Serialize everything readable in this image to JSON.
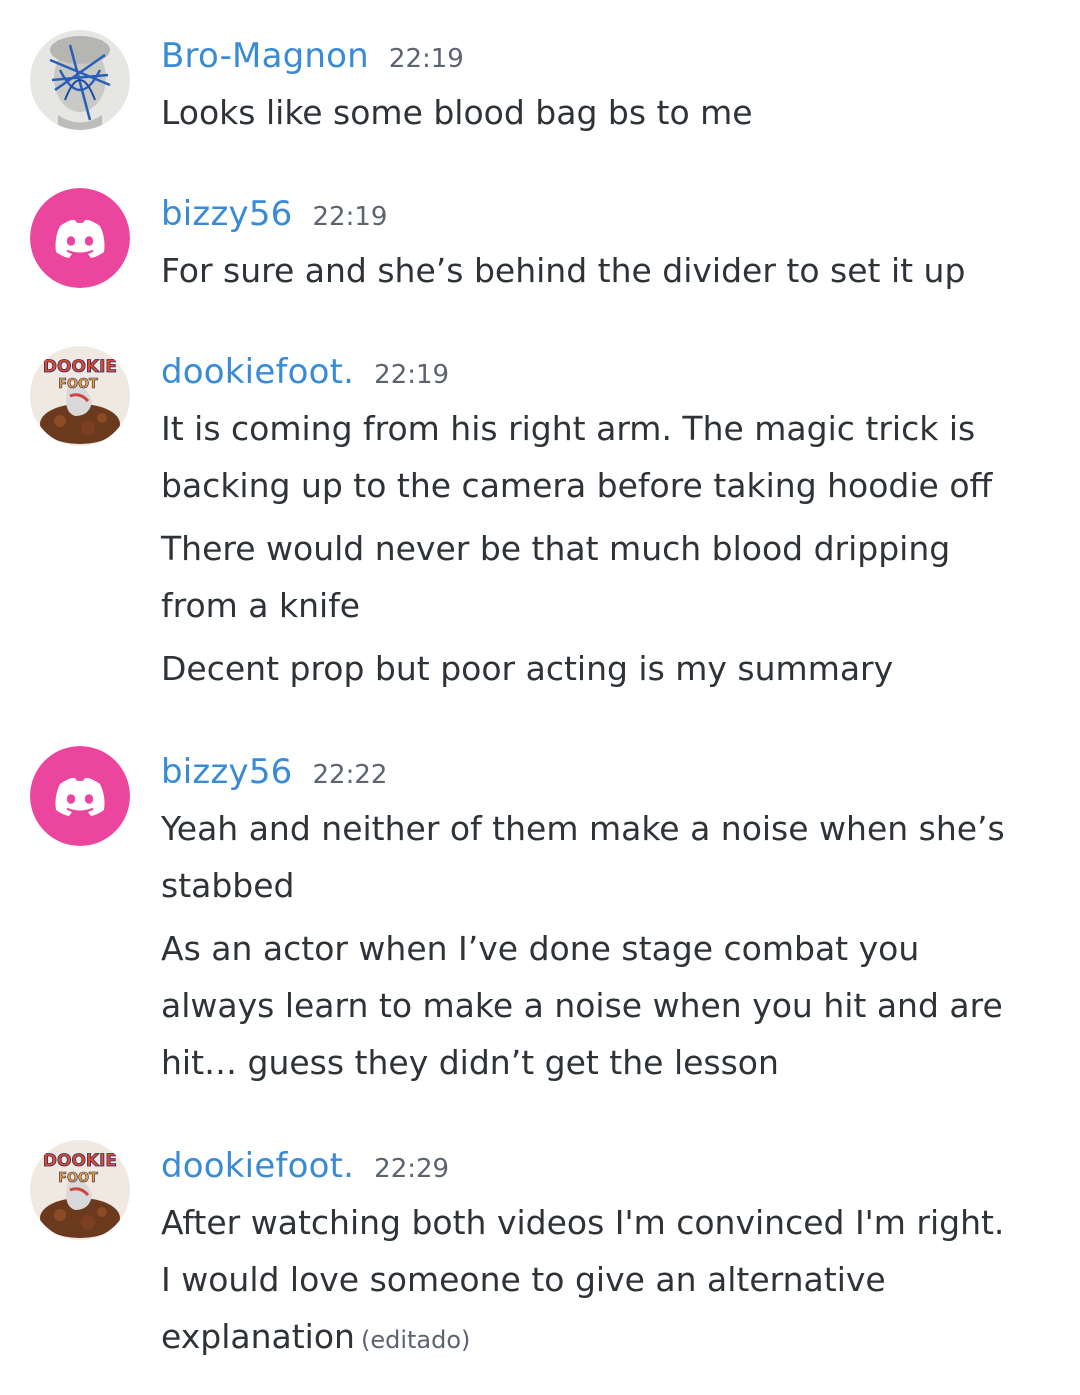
{
  "messages": [
    {
      "username": "Bro-Magnon",
      "time": "22:19",
      "avatar": "statue-avatar",
      "lines": [
        "Looks like some blood bag bs to me"
      ]
    },
    {
      "username": "bizzy56",
      "time": "22:19",
      "avatar": "discord-logo-avatar",
      "avatar_color": "#eb459e",
      "lines": [
        "For sure and she’s behind the divider to set it up"
      ]
    },
    {
      "username": "dookiefoot.",
      "time": "22:19",
      "avatar": "dookie-foot-avatar",
      "lines": [
        "It is coming from his right arm.   The magic trick is",
        "backing up to the camera before taking hoodie off",
        "There would never be that much blood dripping",
        "from a knife",
        "Decent prop but poor acting is my summary"
      ]
    },
    {
      "username": "bizzy56",
      "time": "22:22",
      "avatar": "discord-logo-avatar",
      "avatar_color": "#eb459e",
      "lines": [
        "Yeah and neither of them make a noise when she’s",
        "stabbed",
        "As an actor when I’ve done stage combat you",
        "always learn to make a noise when you hit and are",
        "hit… guess they didn’t get the lesson"
      ]
    },
    {
      "username": "dookiefoot.",
      "time": "22:29",
      "avatar": "dookie-foot-avatar",
      "lines": [
        "After watching both videos I'm convinced I'm right.",
        "I would love someone to give an alternative",
        "explanation"
      ],
      "edited_label": "(editado)"
    }
  ],
  "colors": {
    "username": "#3a8bd6",
    "timestamp": "#5c6470",
    "text": "#2e3338",
    "discord_pink": "#eb459e"
  }
}
